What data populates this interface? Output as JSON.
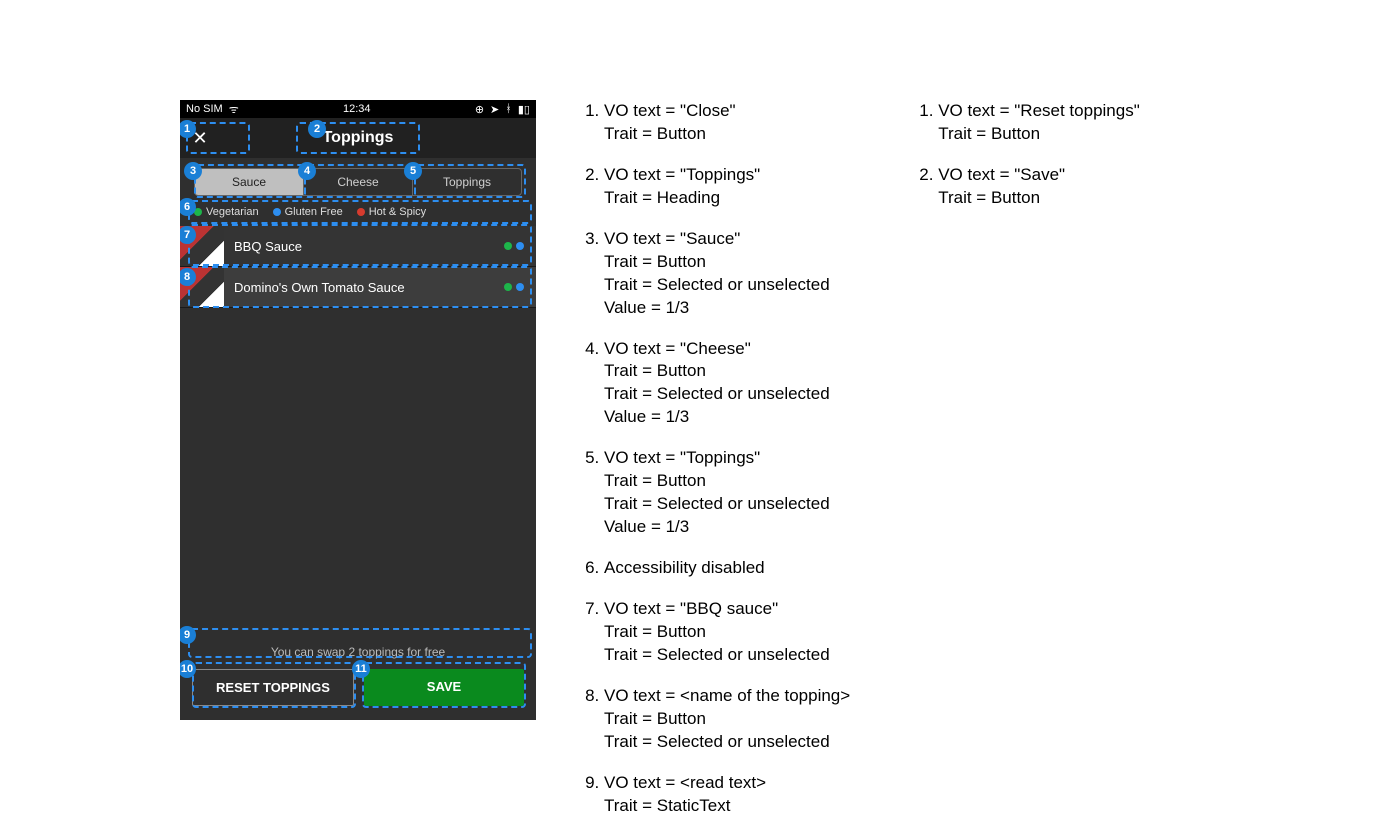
{
  "phone": {
    "status": {
      "carrier": "No SIM",
      "time": "12:34"
    },
    "nav": {
      "close_glyph": "✕",
      "title": "Toppings"
    },
    "segments": {
      "sauce": "Sauce",
      "cheese": "Cheese",
      "toppings": "Toppings"
    },
    "legend": {
      "veg": {
        "label": "Vegetarian",
        "color": "#1db54a"
      },
      "gf": {
        "label": "Gluten Free",
        "color": "#2d8ef0"
      },
      "hot": {
        "label": "Hot & Spicy",
        "color": "#d63b2e"
      }
    },
    "rows": [
      {
        "name": "BBQ Sauce",
        "dots": [
          "#1db54a",
          "#2d8ef0"
        ]
      },
      {
        "name": "Domino's Own Tomato Sauce",
        "dots": [
          "#1db54a",
          "#2d8ef0"
        ]
      }
    ],
    "hint": "You can swap 2 toppings for free",
    "buttons": {
      "reset": "RESET TOPPINGS",
      "save": "SAVE"
    }
  },
  "annotations": {
    "col1": [
      {
        "n": "1",
        "lines": [
          "VO text = \"Close\"",
          "Trait = Button"
        ]
      },
      {
        "n": "2",
        "lines": [
          "VO text = \"Toppings\"",
          "Trait = Heading"
        ]
      },
      {
        "n": "3",
        "lines": [
          "VO text = \"Sauce\"",
          "Trait = Button",
          "Trait = Selected or unselected",
          "Value = 1/3"
        ]
      },
      {
        "n": "4",
        "lines": [
          "VO text = \"Cheese\"",
          "Trait = Button",
          "Trait = Selected or unselected",
          "Value = 1/3"
        ]
      },
      {
        "n": "5",
        "lines": [
          "VO text = \"Toppings\"",
          "Trait = Button",
          "Trait = Selected or unselected",
          "Value = 1/3"
        ]
      },
      {
        "n": "6",
        "lines": [
          "Accessibility disabled"
        ]
      },
      {
        "n": "7",
        "lines": [
          "VO text = \"BBQ sauce\"",
          "Trait = Button",
          "Trait = Selected or unselected"
        ]
      },
      {
        "n": "8",
        "lines": [
          "VO text = <name of the topping>",
          "Trait = Button",
          "Trait = Selected or unselected"
        ]
      },
      {
        "n": "9",
        "lines": [
          "VO text = <read text>",
          "Trait = StaticText"
        ]
      }
    ],
    "col2": [
      {
        "n": "10",
        "lines": [
          "VO text = \"Reset toppings\"",
          "Trait = Button"
        ]
      },
      {
        "n": "11",
        "lines": [
          "VO text = \"Save\"",
          "Trait = Button"
        ]
      }
    ]
  }
}
